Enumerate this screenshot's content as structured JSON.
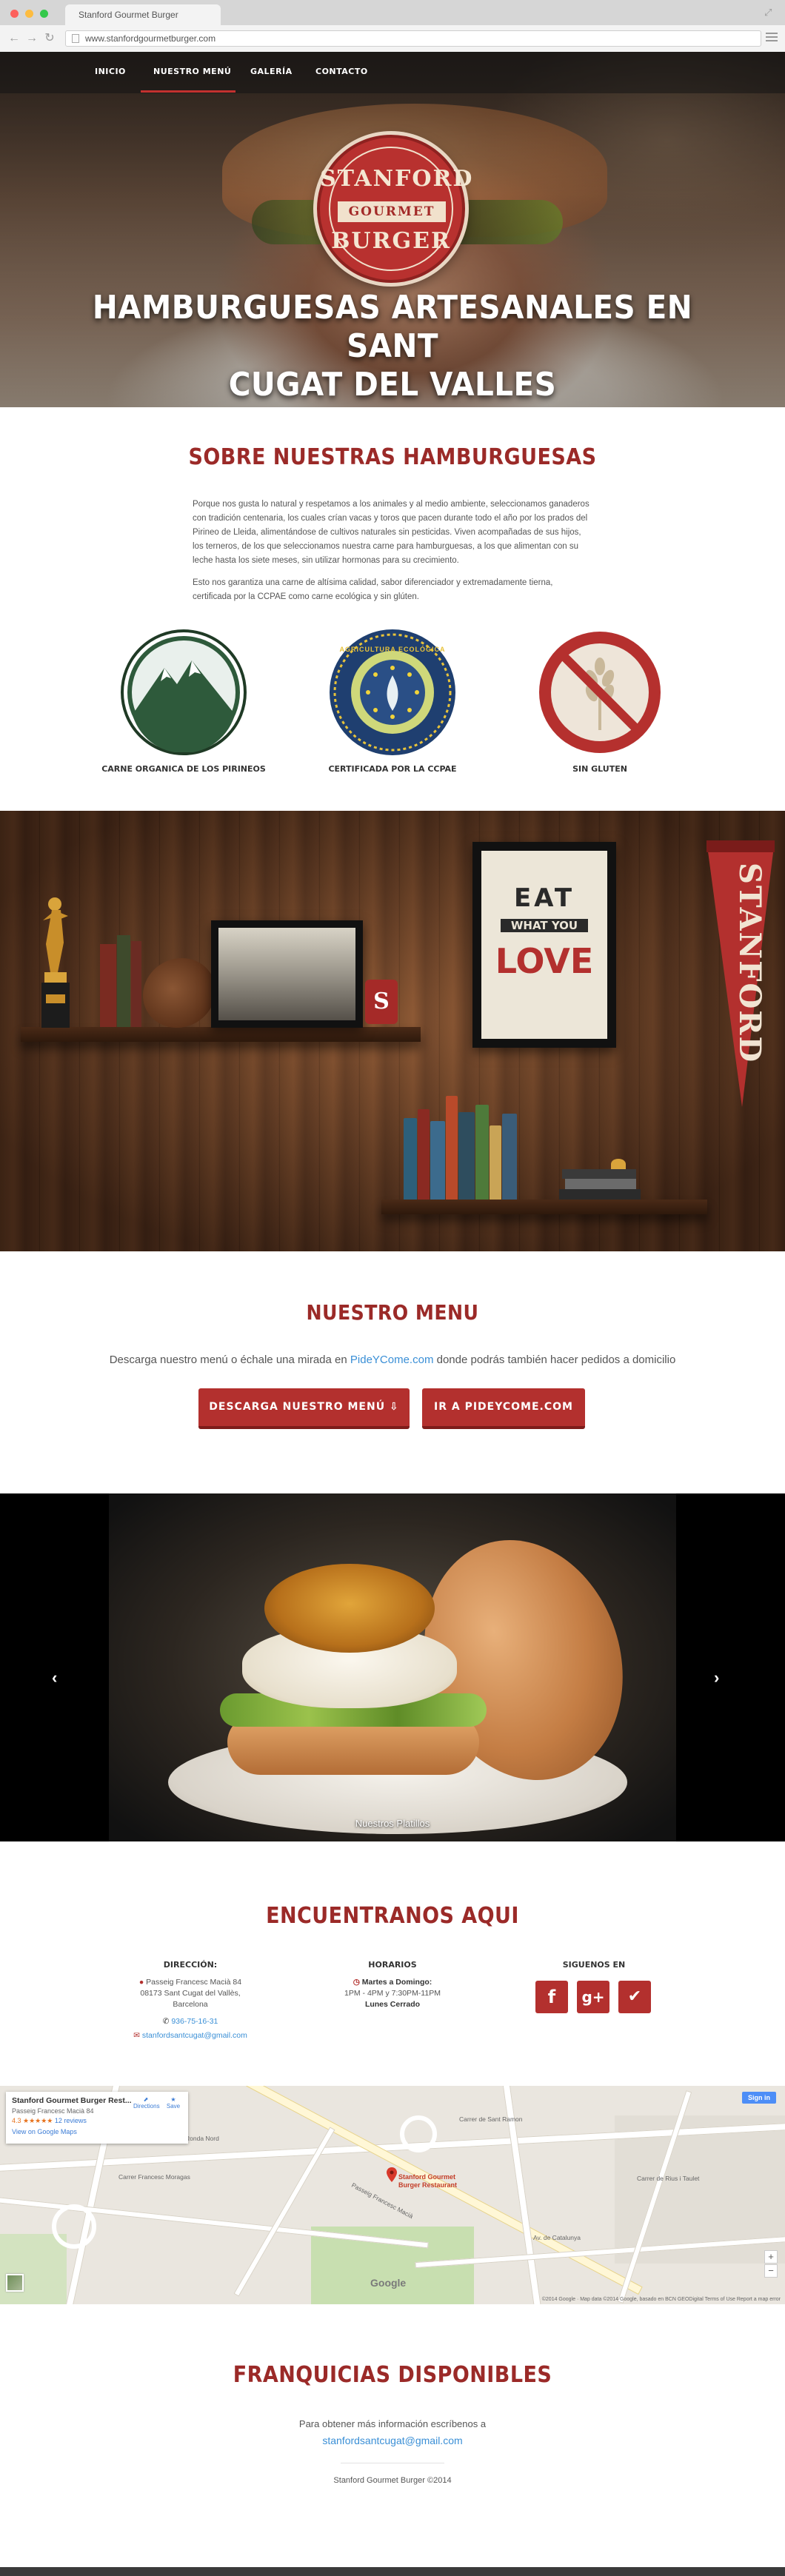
{
  "browser": {
    "tab_title": "Stanford Gourmet Burger",
    "url": "www.stanfordgourmetburger.com"
  },
  "nav": {
    "items": [
      "INICIO",
      "NUESTRO MENÚ",
      "GALERÍA",
      "CONTACTO"
    ],
    "active_index": 1
  },
  "logo": {
    "top": "STANFORD",
    "ribbon": "GOURMET",
    "bottom": "BURGER"
  },
  "hero": {
    "title_line1": "HAMBURGUESAS ARTESANALES EN SANT",
    "title_line2": "CUGAT DEL VALLES"
  },
  "about": {
    "title": "SOBRE NUESTRAS HAMBURGUESAS",
    "paragraph1": "Porque nos gusta lo natural y respetamos a los animales y al medio ambiente, seleccionamos ganaderos con tradición centenaria, los cuales crían vacas y toros que pacen durante todo el año por los prados del Pirineo de Lleida, alimentándose de cultivos naturales sin pesticidas. Viven acompañadas de sus hijos, los terneros, de los que seleccionamos nuestra carne para hamburguesas, a los que alimentan con su leche hasta los siete meses, sin utilizar hormonas para su crecimiento.",
    "paragraph2": "Esto nos garantiza una carne de altísima calidad, sabor diferenciador y extremadamente tierna, certificada por la CCPAE como carne ecológica y sin glúten.",
    "badges": [
      {
        "caption": "CARNE ORGANICA DE LOS PIRINEOS",
        "icon": "mountain-icon"
      },
      {
        "caption": "CERTIFICADA POR LA CCPAE",
        "icon": "organic-seal-icon",
        "seal_text": "AGRICULTURA ECOLÓGICA"
      },
      {
        "caption": "SIN GLUTEN",
        "icon": "no-gluten-icon"
      }
    ]
  },
  "decor": {
    "poster_line1": "EAT",
    "poster_line2": "WHAT YOU",
    "poster_line3": "LOVE",
    "pennant": "STANFORD",
    "shelf_badge": "S",
    "trophy_book": "STANFORD"
  },
  "menu": {
    "title": "NUESTRO MENU",
    "text_before": "Descarga nuestro menú o échale una mirada en ",
    "link": "PideYCome.com",
    "text_after": " donde podrás también hacer pedidos a domicilio",
    "download_button": "DESCARGA NUESTRO MENÚ ⇩",
    "pideycome_button": "IR A PIDEYCOME.COM"
  },
  "slider": {
    "caption": "Nuestros Platillos",
    "prev": "‹",
    "next": "›"
  },
  "contact": {
    "title": "ENCUENTRANOS AQUI",
    "address_title": "DIRECCIÓN:",
    "address_line1": "Passeig Francesc Macià 84",
    "address_line2": "08173 Sant Cugat del Vallès,",
    "address_line3": "Barcelona",
    "phone": "936-75-16-31",
    "email": "stanfordsantcugat@gmail.com",
    "hours_title": "HORARIOS",
    "hours_days": "Martes a Domingo:",
    "hours_times": "1PM - 4PM y 7:30PM-11PM",
    "hours_closed": "Lunes Cerrado",
    "social_title": "SIGUENOS EN",
    "social": [
      {
        "name": "facebook",
        "glyph": "f"
      },
      {
        "name": "google-plus",
        "glyph": "g+"
      },
      {
        "name": "foursquare",
        "glyph": "✔"
      }
    ]
  },
  "map": {
    "card_title": "Stanford Gourmet Burger Rest...",
    "card_address": "Passeig Francesc Macià 84",
    "card_rating": "4.3 ★★★★★",
    "card_reviews": "12 reviews",
    "card_link": "View on Google Maps",
    "directions": "Directions",
    "save": "Save",
    "signin": "Sign in",
    "pin_label_line1": "Stanford Gourmet",
    "pin_label_line2": "Burger Restaurant",
    "streets": [
      "Ronda Nord",
      "Carrer de Sant Ramon",
      "Passeig Francesc Macià",
      "Carrer Francesc Moragas",
      "Av. de Catalunya",
      "Carrer de Rius i Taulet"
    ],
    "footer": "©2014 Google · Map data ©2014 Google, basado en BCN GEODigital   Terms of Use   Report a map error",
    "google": "Google"
  },
  "franchise": {
    "title": "FRANQUICIAS DISPONIBLES",
    "text": "Para obtener más información escríbenos a",
    "email": "stanfordsantcugat@gmail.com",
    "copyright": "Stanford Gourmet Burger ©2014"
  },
  "colors": {
    "brand_red": "#9b2a28",
    "button_red": "#b3302e",
    "link_blue": "#3a8fd6"
  }
}
